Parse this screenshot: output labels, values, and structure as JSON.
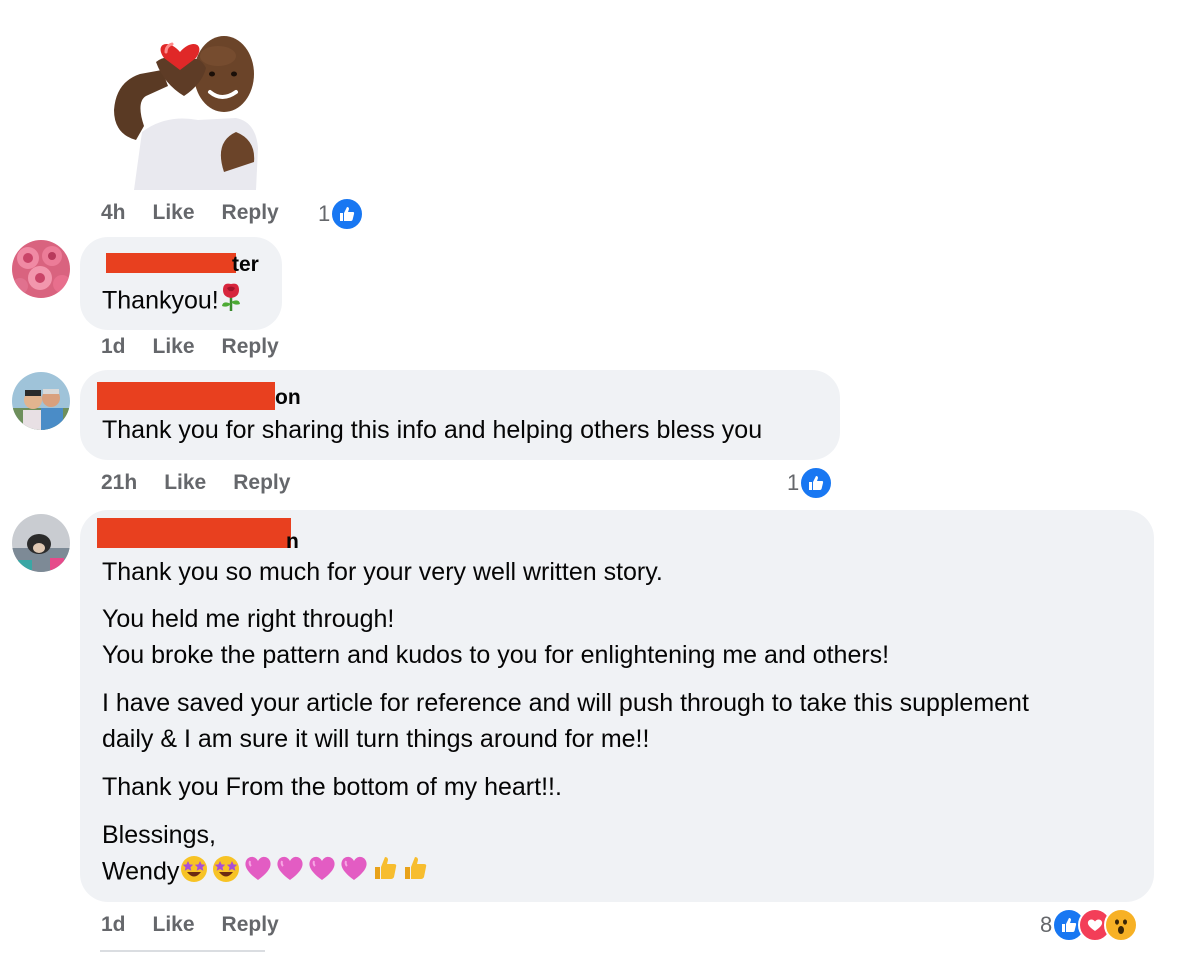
{
  "comments": [
    {
      "time": "4h",
      "like_label": "Like",
      "reply_label": "Reply",
      "reaction_count": "1"
    },
    {
      "name_visible": "ter",
      "text": "Thankyou!",
      "time": "1d",
      "like_label": "Like",
      "reply_label": "Reply"
    },
    {
      "name_visible": "on",
      "text": "Thank you for sharing this info and helping others bless you",
      "time": "21h",
      "like_label": "Like",
      "reply_label": "Reply",
      "reaction_count": "1"
    },
    {
      "name_visible": "n",
      "lines": [
        "Thank you so much for your very well written story.",
        "You held me right through!",
        "You broke the pattern and kudos to you for enlightening me and others!",
        "I have saved your article for reference and will push through to take this supplement",
        "daily & I am sure it will turn things around for me!!",
        "Thank you From the bottom of my heart!!.",
        "Blessings,",
        "Wendy"
      ],
      "time": "1d",
      "like_label": "Like",
      "reply_label": "Reply",
      "reaction_count": "8"
    }
  ],
  "colors": {
    "bubble": "#f0f2f5",
    "meta_text": "#65676b",
    "like_blue": "#1877f2",
    "redaction": "#e8401f"
  }
}
